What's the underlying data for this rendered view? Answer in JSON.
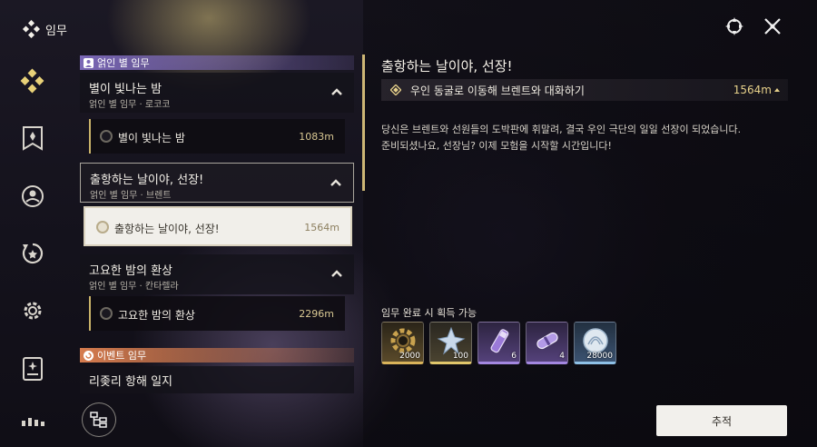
{
  "header": {
    "title": "임무"
  },
  "categories": [
    {
      "label": "얽인 별 임무",
      "color": "#7b68b6"
    },
    {
      "label": "이벤트 임무",
      "color": "#d67c4f"
    }
  ],
  "groups": [
    {
      "title": "별이 빛나는 밤",
      "subtitle": "얽인 별 임무 · 로코코",
      "quest": {
        "title": "별이 빛나는 밤",
        "distance": "1083m"
      }
    },
    {
      "title": "출항하는 날이야, 선장!",
      "subtitle": "얽인 별 임무 · 브렌트",
      "quest": {
        "title": "출항하는 날이야, 선장!",
        "distance": "1564m"
      }
    },
    {
      "title": "고요한 밤의 환상",
      "subtitle": "얽인 별 임무 · 칸타렐라",
      "quest": {
        "title": "고요한 밤의 환상",
        "distance": "2296m"
      }
    }
  ],
  "event_group_partial": "리좆리 항해 일지",
  "detail": {
    "title": "출항하는 날이야, 선장!",
    "objective": "우인 동굴로 이동해 브렌트와 대화하기",
    "objective_distance": "1564m",
    "description_line1": "당신은 브렌트와 선원들의 도박판에 휘말려, 결국 우인 극단의 일일 선장이 되었습니다.",
    "description_line2": "준비되셨나요, 선장님? 이제 모험을 시작할 시간입니다!",
    "rewards_label": "임무 완료 시 획득 가능",
    "rewards": [
      {
        "icon": "gear-icon",
        "count": "2000"
      },
      {
        "icon": "star-crystal-icon",
        "count": "100"
      },
      {
        "icon": "purple-vial-icon",
        "count": "6"
      },
      {
        "icon": "purple-capsule-icon",
        "count": "4"
      },
      {
        "icon": "shell-coin-icon",
        "count": "28000"
      }
    ],
    "track_label": "추적"
  },
  "colors": {
    "accent_gold": "#cdb675",
    "selected_bg": "#f1efea"
  }
}
